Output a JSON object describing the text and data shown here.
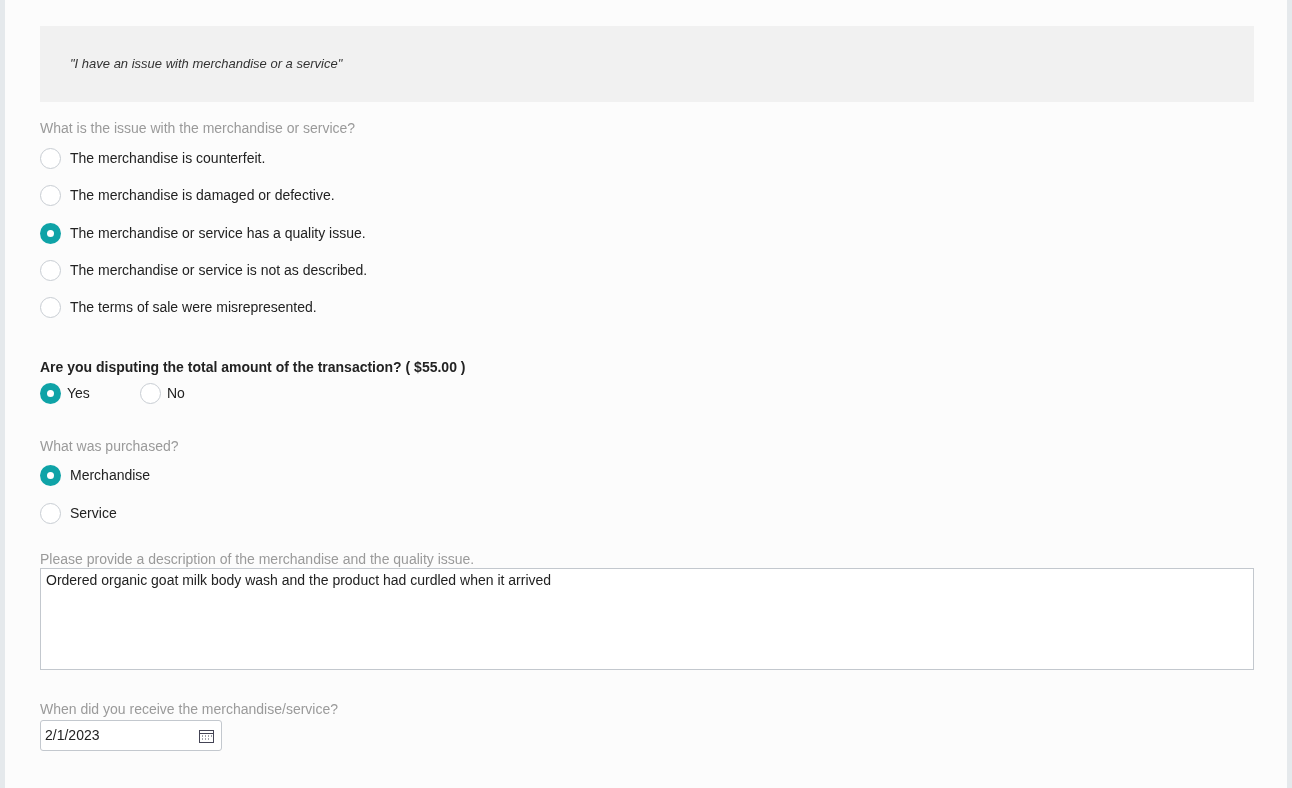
{
  "banner": {
    "quote": "\"I have an issue with merchandise or a service\""
  },
  "issue": {
    "label": "What is the issue with the merchandise or service?",
    "options": [
      {
        "label": "The merchandise is counterfeit.",
        "selected": false
      },
      {
        "label": "The merchandise is damaged or defective.",
        "selected": false
      },
      {
        "label": "The merchandise or service has a quality issue.",
        "selected": true
      },
      {
        "label": "The merchandise or service is not as described.",
        "selected": false
      },
      {
        "label": "The terms of sale were misrepresented.",
        "selected": false
      }
    ]
  },
  "dispute": {
    "label": "Are you disputing the total amount of the transaction? ( $55.00  )",
    "options": [
      {
        "label": "Yes",
        "selected": true
      },
      {
        "label": "No",
        "selected": false
      }
    ]
  },
  "purchased": {
    "label": "What was purchased?",
    "options": [
      {
        "label": "Merchandise",
        "selected": true
      },
      {
        "label": "Service",
        "selected": false
      }
    ]
  },
  "description": {
    "label": "Please provide a description of the merchandise and the quality issue.",
    "value": "Ordered organic goat milk body wash and the product had curdled when it arrived"
  },
  "received": {
    "label": "When did you receive the merchandise/service?",
    "value": "2/1/2023"
  }
}
